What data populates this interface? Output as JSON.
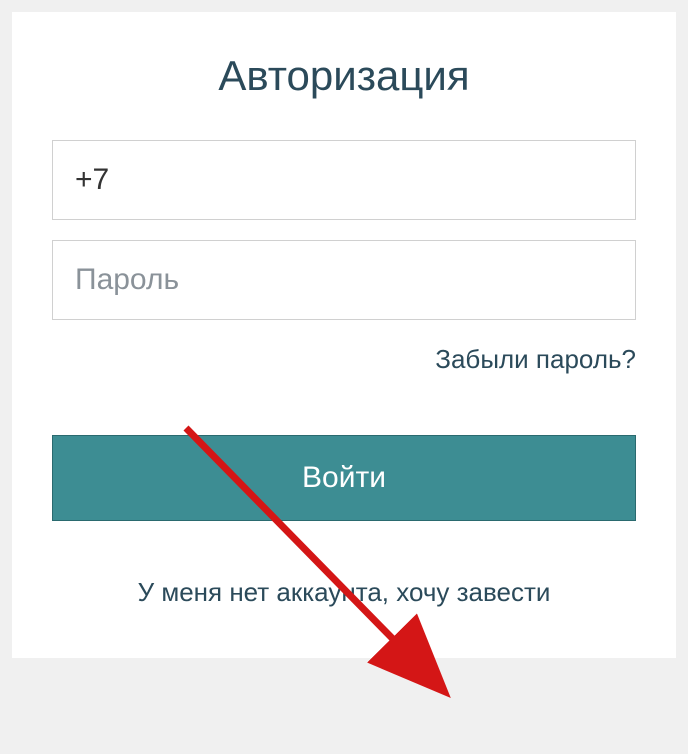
{
  "form": {
    "title": "Авторизация",
    "phone_value": "+7",
    "password_placeholder": "Пароль",
    "forgot_label": "Забыли пароль?",
    "login_label": "Войти",
    "register_label": "У меня нет аккаунта, хочу завести"
  },
  "colors": {
    "accent": "#3d8d93",
    "text_dark": "#2b4a5a",
    "arrow": "#d41616"
  }
}
